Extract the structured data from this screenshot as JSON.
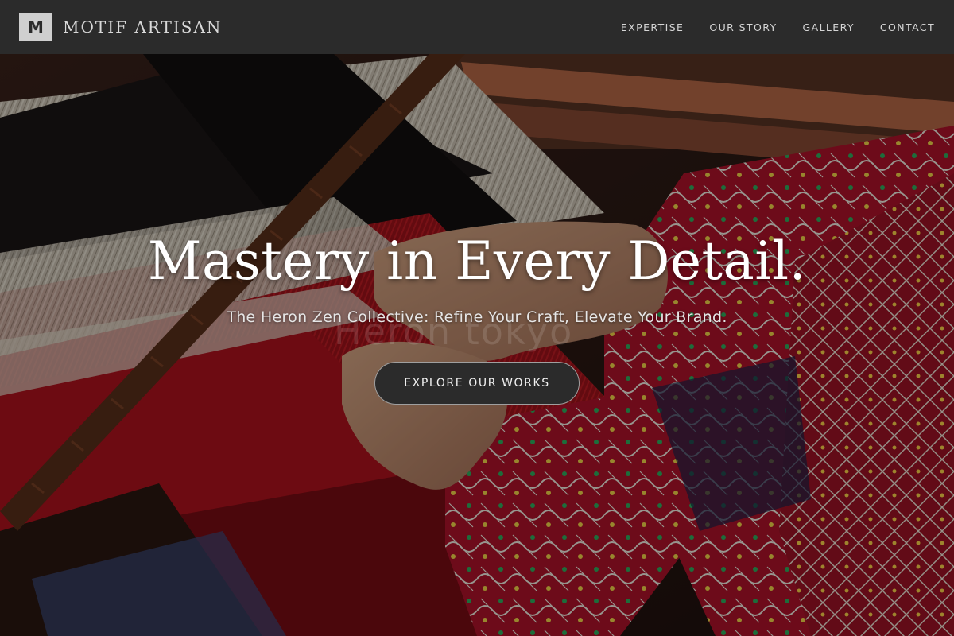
{
  "header": {
    "logo_letter": "M",
    "brand_name": "MOTIF ARTISAN",
    "nav": [
      {
        "label": "EXPERTISE"
      },
      {
        "label": "OUR STORY"
      },
      {
        "label": "GALLERY"
      },
      {
        "label": "CONTACT"
      }
    ]
  },
  "hero": {
    "title": "Mastery in Every Detail.",
    "subtitle": "The Heron Zen Collective: Refine Your Craft, Elevate Your Brand.",
    "cta_label": "EXPLORE OUR WORKS",
    "watermark": "Heron tokyo",
    "background_description_icon": "weaving-loom-image"
  },
  "colors": {
    "header_bg": "#2b2b2b",
    "logo_bg": "#cfcfcf",
    "cta_bg": "#2b2b2b",
    "text_light": "#ffffff"
  }
}
